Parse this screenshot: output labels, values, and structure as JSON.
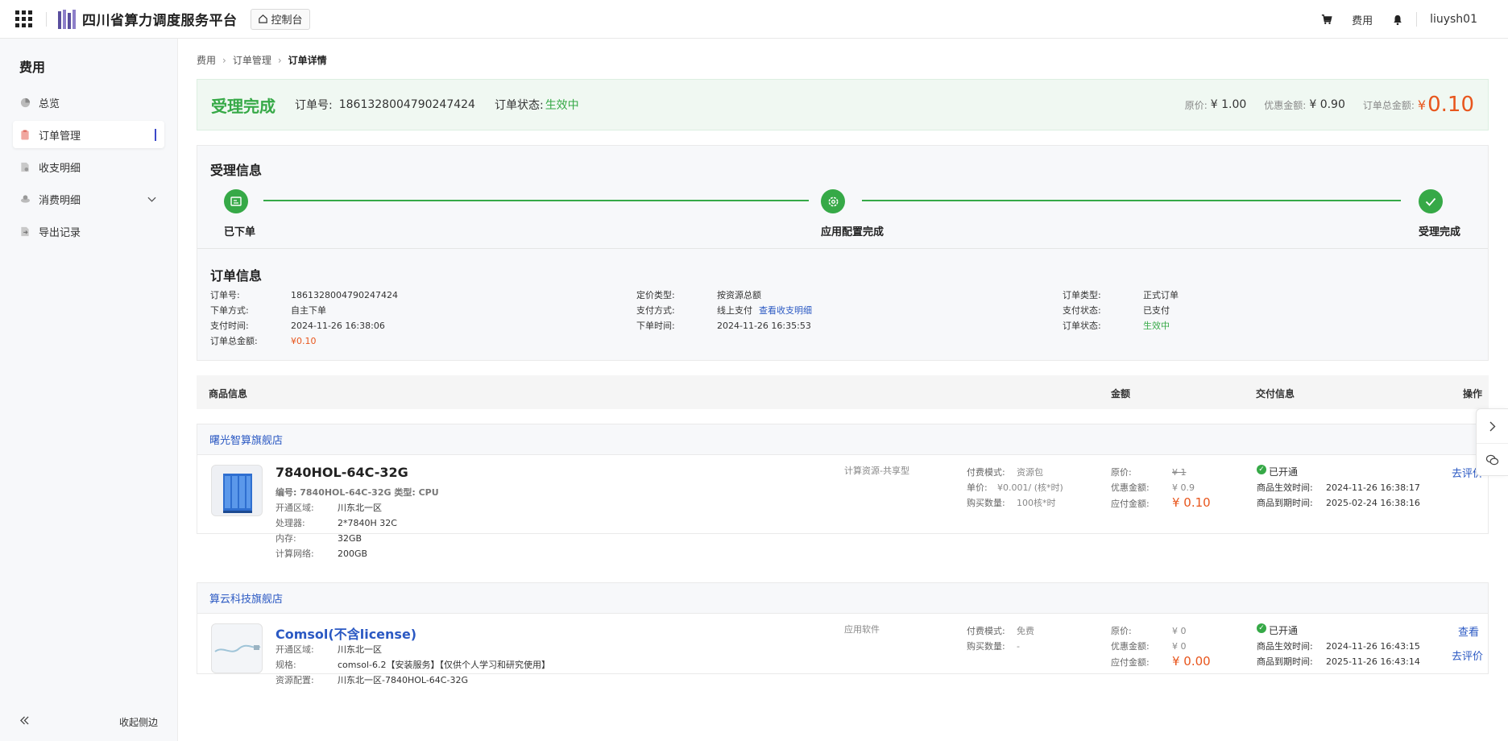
{
  "topbar": {
    "title": "四川省算力调度服务平台",
    "console_label": "控制台",
    "fee_label": "费用",
    "username": "liuysh01"
  },
  "sidebar": {
    "title": "费用",
    "items": [
      {
        "label": "总览",
        "icon": "pie-chart-icon"
      },
      {
        "label": "订单管理",
        "icon": "order-icon"
      },
      {
        "label": "收支明细",
        "icon": "ledger-icon"
      },
      {
        "label": "消费明细",
        "icon": "consumption-icon"
      },
      {
        "label": "导出记录",
        "icon": "export-icon"
      }
    ],
    "collapse_label": "收起侧边"
  },
  "breadcrumb": [
    "费用",
    "订单管理",
    "订单详情"
  ],
  "status": {
    "big": "受理完成",
    "order_no_label": "订单号:",
    "order_no": "1861328004790247424",
    "state_label": "订单状态:",
    "state": "生效中",
    "orig_label": "原价:",
    "orig": "¥ 1.00",
    "discount_label": "优惠金额:",
    "discount": "¥ 0.90",
    "total_label": "订单总金额:",
    "total_cur": "¥",
    "total": "0.10"
  },
  "progress": {
    "title": "受理信息",
    "steps": [
      "已下单",
      "应用配置完成",
      "受理完成"
    ]
  },
  "order_info": {
    "title": "订单信息",
    "col1": [
      {
        "k": "订单号:",
        "v": "1861328004790247424"
      },
      {
        "k": "下单方式:",
        "v": "自主下单"
      },
      {
        "k": "支付时间:",
        "v": "2024-11-26 16:38:06"
      },
      {
        "k": "订单总金额:",
        "v": "¥0.10"
      }
    ],
    "col2": [
      {
        "k": "定价类型:",
        "v": "按资源总额"
      },
      {
        "k": "支付方式:",
        "v": "线上支付",
        "link": "查看收支明细"
      },
      {
        "k": "下单时间:",
        "v": "2024-11-26 16:35:53"
      }
    ],
    "col3": [
      {
        "k": "订单类型:",
        "v": "正式订单"
      },
      {
        "k": "支付状态:",
        "v": "已支付"
      },
      {
        "k": "订单状态:",
        "v": "生效中"
      }
    ]
  },
  "table_headers": {
    "product": "商品信息",
    "amount": "金额",
    "delivery": "交付信息",
    "action": "操作"
  },
  "shops": [
    {
      "name": "曙光智算旗舰店",
      "product": {
        "name": "7840HOL-64C-32G",
        "sub": "编号: 7840HOL-64C-32G  类型: CPU",
        "specs": [
          {
            "k": "开通区域:",
            "v": "川东北一区"
          },
          {
            "k": "处理器:",
            "v": "2*7840H 32C"
          },
          {
            "k": "内存:",
            "v": "32GB"
          },
          {
            "k": "计算网络:",
            "v": "200GB"
          }
        ],
        "category": "计算资源-共享型",
        "billing": [
          {
            "k": "付费模式:",
            "v": "资源包"
          },
          {
            "k": "单价:",
            "v": "¥0.001/ (核*时)"
          },
          {
            "k": "购买数量:",
            "v": "100核*时"
          }
        ],
        "amounts": {
          "orig_label": "原价:",
          "orig": "¥ 1",
          "disc_label": "优惠金额:",
          "disc": "¥ 0.9",
          "pay_label": "应付金额:",
          "pay": "¥ 0.10"
        },
        "delivery": {
          "status": "已开通",
          "start_label": "商品生效时间:",
          "start": "2024-11-26 16:38:17",
          "end_label": "商品到期时间:",
          "end": "2025-02-24 16:38:16"
        },
        "actions": [
          "去评价"
        ]
      }
    },
    {
      "name": "算云科技旗舰店",
      "product": {
        "name": "Comsol(不含license)",
        "specs": [
          {
            "k": "开通区域:",
            "v": "川东北一区"
          },
          {
            "k": "规格:",
            "v": "comsol-6.2【安装服务】【仅供个人学习和研究使用】"
          },
          {
            "k": "资源配置:",
            "v": "川东北一区-7840HOL-64C-32G"
          }
        ],
        "category": "应用软件",
        "billing": [
          {
            "k": "付费模式:",
            "v": "免费"
          },
          {
            "k": "购买数量:",
            "v": "-"
          }
        ],
        "amounts": {
          "orig_label": "原价:",
          "orig": "¥ 0",
          "disc_label": "优惠金额:",
          "disc": "¥ 0",
          "pay_label": "应付金额:",
          "pay": "¥ 0.00"
        },
        "delivery": {
          "status": "已开通",
          "start_label": "商品生效时间:",
          "start": "2024-11-26 16:43:15",
          "end_label": "商品到期时间:",
          "end": "2025-11-26 16:43:14"
        },
        "actions": [
          "查看",
          "去评价"
        ]
      }
    }
  ],
  "colors": {
    "accent": "#36a947",
    "price": "#e8561d",
    "link": "#2b59c3"
  }
}
